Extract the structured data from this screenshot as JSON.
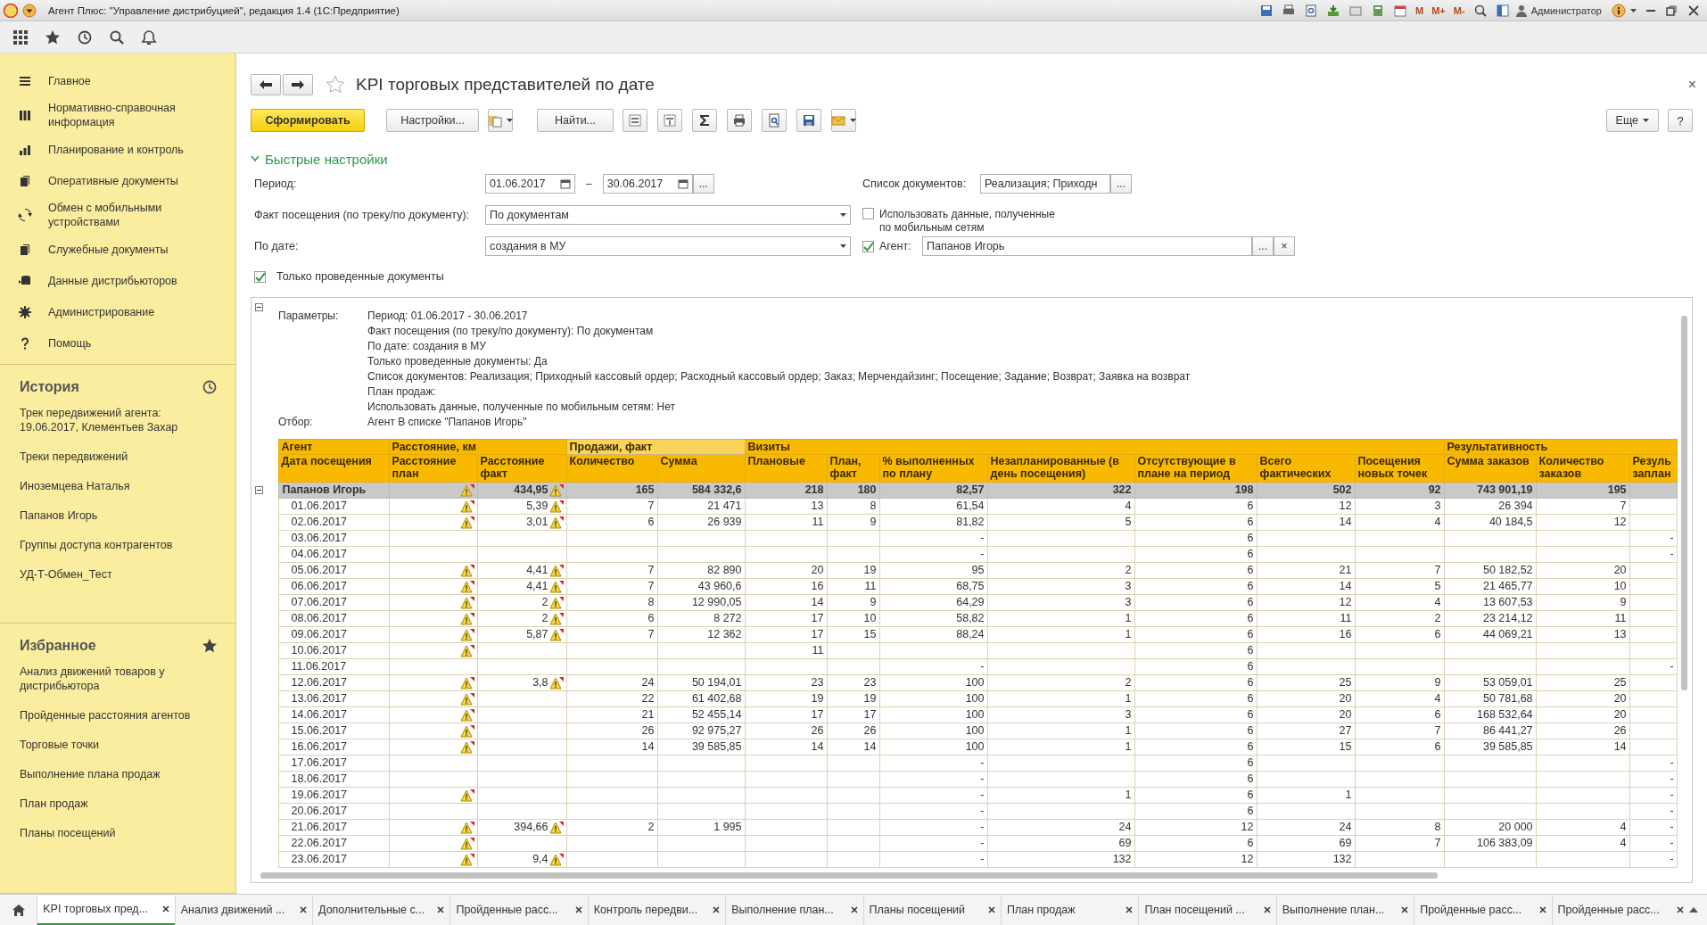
{
  "window": {
    "title": "Агент Плюс: \"Управление дистрибуцией\", редакция 1.4  (1С:Предприятие)",
    "memory_buttons": [
      "M",
      "M+",
      "M-"
    ],
    "user": "Администратор"
  },
  "sidebar": {
    "sections": [
      {
        "label": "Главное",
        "kind": "menu"
      },
      {
        "label": "Нормативно-справочная информация",
        "kind": "books"
      },
      {
        "label": "Планирование и контроль",
        "kind": "chart"
      },
      {
        "label": "Оперативные документы",
        "kind": "docs"
      },
      {
        "label": "Обмен с мобильными устройствами",
        "kind": "sync"
      },
      {
        "label": "Служебные документы",
        "kind": "docs"
      },
      {
        "label": "Данные дистрибьюторов",
        "kind": "db"
      },
      {
        "label": "Администрирование",
        "kind": "gear"
      },
      {
        "label": "Помощь",
        "kind": "help"
      }
    ],
    "history": {
      "title": "История",
      "items": [
        "Трек передвижений агента: 19.06.2017, Клементьев Захар",
        "Треки передвижений",
        "Иноземцева Наталья",
        "Папанов Игорь",
        "Группы доступа контрагентов",
        "УД-Т-Обмен_Тест"
      ]
    },
    "favorites": {
      "title": "Избранное",
      "items": [
        "Анализ движений товаров у дистрибьютора",
        "Пройденные расстояния агентов",
        "Торговые точки",
        "Выполнение плана продаж",
        "План продаж",
        "Планы посещений"
      ]
    }
  },
  "form": {
    "title": "KPI торговых представителей по дате",
    "close": "×",
    "toolbar": {
      "generate": "Сформировать",
      "settings": "Настройки...",
      "find": "Найти...",
      "more": "Еще",
      "help": "?"
    },
    "quick_settings": {
      "title": "Быстрые настройки",
      "expanded": true,
      "period": {
        "label": "Период:",
        "from": "01.06.2017",
        "dash": "–",
        "to": "30.06.2017",
        "more": "..."
      },
      "visit": {
        "label": "Факт посещения (по треку/по документу):",
        "value": "По документам"
      },
      "by_date": {
        "label": "По дате:",
        "value": "создания в МУ"
      },
      "posted_only": {
        "label": "Только проведенные документы",
        "checked": true
      },
      "doc_list": {
        "label": "Список документов:",
        "value": "Реализация; Приходн",
        "more": "..."
      },
      "mobile": {
        "label": "Использовать данные, полученные по мобильным сетям",
        "checked": false
      },
      "agent": {
        "label": "Агент:",
        "checked": true,
        "value": "Папанов Игорь",
        "more": "...",
        "clear": "×"
      }
    }
  },
  "report": {
    "parameters": [
      {
        "label": "Параметры:",
        "lines": [
          "Период: 01.06.2017 - 30.06.2017",
          "Факт посещения (по треку/по документу): По документам",
          "По дате: создания в МУ",
          "Только проведенные документы: Да",
          "Список документов: Реализация; Приходный кассовый ордер; Расходный кассовый ордер; Заказ; Мерчендайзинг; Посещение; Задание; Возврат; Заявка на возврат",
          "План продаж:",
          "Использовать данные, полученные по мобильным сетям: Нет"
        ]
      },
      {
        "label": "Отбор:",
        "lines": [
          "Агент В списке \"Папанов Игорь\""
        ]
      }
    ],
    "table": {
      "groups": [
        {
          "label": "Агент",
          "columns": [
            "Дата посещения"
          ]
        },
        {
          "label": "Расстояние, км",
          "columns": [
            "Расстояние план",
            "Расстояние факт"
          ]
        },
        {
          "label": "Продажи, факт",
          "columns": [
            "Количество",
            "Сумма"
          ]
        },
        {
          "label": "Визиты",
          "columns": [
            "Плановые",
            "План, факт",
            "% выполненных по плану",
            "Незапланированные (в день посещения)",
            "Отсутствующие в плане на период",
            "Всего фактических",
            "Посещения новых точек"
          ]
        },
        {
          "label": "Результативность",
          "columns": [
            "Сумма заказов",
            "Количество заказов",
            "Резуль заплан"
          ]
        }
      ],
      "rows": [
        {
          "kind": "group",
          "expanded": true,
          "date": "Папанов Игорь",
          "plan_warning": true,
          "fact_warning": true,
          "cells": [
            null,
            "434,95",
            "165",
            "584 332,6",
            "218",
            "180",
            "82,57",
            "322",
            "198",
            "502",
            "92",
            "743 901,19",
            "195",
            null
          ]
        },
        {
          "kind": "date",
          "date": "01.06.2017",
          "plan_warning": true,
          "fact_warning": true,
          "cells": [
            null,
            "5,39",
            "7",
            "21 471",
            "13",
            "8",
            "61,54",
            "4",
            "6",
            "12",
            "3",
            "26 394",
            "7",
            null
          ]
        },
        {
          "kind": "date",
          "date": "02.06.2017",
          "plan_warning": true,
          "fact_warning": true,
          "cells": [
            null,
            "3,01",
            "6",
            "26 939",
            "11",
            "9",
            "81,82",
            "5",
            "6",
            "14",
            "4",
            "40 184,5",
            "12",
            null
          ]
        },
        {
          "kind": "date",
          "date": "03.06.2017",
          "plan_warning": false,
          "fact_warning": false,
          "cells": [
            null,
            null,
            null,
            null,
            null,
            null,
            "-",
            null,
            "6",
            null,
            null,
            null,
            null,
            "-"
          ]
        },
        {
          "kind": "date",
          "date": "04.06.2017",
          "plan_warning": false,
          "fact_warning": false,
          "cells": [
            null,
            null,
            null,
            null,
            null,
            null,
            "-",
            null,
            "6",
            null,
            null,
            null,
            null,
            "-"
          ]
        },
        {
          "kind": "date",
          "date": "05.06.2017",
          "plan_warning": true,
          "fact_warning": true,
          "cells": [
            null,
            "4,41",
            "7",
            "82 890",
            "20",
            "19",
            "95",
            "2",
            "6",
            "21",
            "7",
            "50 182,52",
            "20",
            null
          ]
        },
        {
          "kind": "date",
          "date": "06.06.2017",
          "plan_warning": true,
          "fact_warning": true,
          "cells": [
            null,
            "4,41",
            "7",
            "43 960,6",
            "16",
            "11",
            "68,75",
            "3",
            "6",
            "14",
            "5",
            "21 465,77",
            "10",
            null
          ]
        },
        {
          "kind": "date",
          "date": "07.06.2017",
          "plan_warning": true,
          "fact_warning": true,
          "cells": [
            null,
            "2",
            "8",
            "12 990,05",
            "14",
            "9",
            "64,29",
            "3",
            "6",
            "12",
            "4",
            "13 607,53",
            "9",
            null
          ]
        },
        {
          "kind": "date",
          "date": "08.06.2017",
          "plan_warning": true,
          "fact_warning": true,
          "cells": [
            null,
            "2",
            "6",
            "8 272",
            "17",
            "10",
            "58,82",
            "1",
            "6",
            "11",
            "2",
            "23 214,12",
            "11",
            null
          ]
        },
        {
          "kind": "date",
          "date": "09.06.2017",
          "plan_warning": true,
          "fact_warning": true,
          "cells": [
            null,
            "5,87",
            "7",
            "12 362",
            "17",
            "15",
            "88,24",
            "1",
            "6",
            "16",
            "6",
            "44 069,21",
            "13",
            null
          ]
        },
        {
          "kind": "date",
          "date": "10.06.2017",
          "plan_warning": true,
          "fact_warning": false,
          "cells": [
            null,
            null,
            null,
            null,
            "11",
            null,
            null,
            null,
            "6",
            null,
            null,
            null,
            null,
            null
          ]
        },
        {
          "kind": "date",
          "date": "11.06.2017",
          "plan_warning": false,
          "fact_warning": false,
          "cells": [
            null,
            null,
            null,
            null,
            null,
            null,
            "-",
            null,
            "6",
            null,
            null,
            null,
            null,
            "-"
          ]
        },
        {
          "kind": "date",
          "date": "12.06.2017",
          "plan_warning": true,
          "fact_warning": true,
          "cells": [
            null,
            "3,8",
            "24",
            "50 194,01",
            "23",
            "23",
            "100",
            "2",
            "6",
            "25",
            "9",
            "53 059,01",
            "25",
            null
          ]
        },
        {
          "kind": "date",
          "date": "13.06.2017",
          "plan_warning": true,
          "fact_warning": false,
          "cells": [
            null,
            null,
            "22",
            "61 402,68",
            "19",
            "19",
            "100",
            "1",
            "6",
            "20",
            "4",
            "50 781,68",
            "20",
            null
          ]
        },
        {
          "kind": "date",
          "date": "14.06.2017",
          "plan_warning": true,
          "fact_warning": false,
          "cells": [
            null,
            null,
            "21",
            "52 455,14",
            "17",
            "17",
            "100",
            "3",
            "6",
            "20",
            "6",
            "168 532,64",
            "20",
            null
          ]
        },
        {
          "kind": "date",
          "date": "15.06.2017",
          "plan_warning": true,
          "fact_warning": false,
          "cells": [
            null,
            null,
            "26",
            "92 975,27",
            "26",
            "26",
            "100",
            "1",
            "6",
            "27",
            "7",
            "86 441,27",
            "26",
            null
          ]
        },
        {
          "kind": "date",
          "date": "16.06.2017",
          "plan_warning": true,
          "fact_warning": false,
          "cells": [
            null,
            null,
            "14",
            "39 585,85",
            "14",
            "14",
            "100",
            "1",
            "6",
            "15",
            "6",
            "39 585,85",
            "14",
            null
          ]
        },
        {
          "kind": "date",
          "date": "17.06.2017",
          "plan_warning": false,
          "fact_warning": false,
          "cells": [
            null,
            null,
            null,
            null,
            null,
            null,
            "-",
            null,
            "6",
            null,
            null,
            null,
            null,
            "-"
          ]
        },
        {
          "kind": "date",
          "date": "18.06.2017",
          "plan_warning": false,
          "fact_warning": false,
          "cells": [
            null,
            null,
            null,
            null,
            null,
            null,
            "-",
            null,
            "6",
            null,
            null,
            null,
            null,
            "-"
          ]
        },
        {
          "kind": "date",
          "date": "19.06.2017",
          "plan_warning": true,
          "fact_warning": false,
          "cells": [
            null,
            null,
            null,
            null,
            null,
            null,
            "-",
            "1",
            "6",
            "1",
            null,
            null,
            null,
            "-"
          ]
        },
        {
          "kind": "date",
          "date": "20.06.2017",
          "plan_warning": false,
          "fact_warning": false,
          "cells": [
            null,
            null,
            null,
            null,
            null,
            null,
            "-",
            null,
            "6",
            null,
            null,
            null,
            null,
            "-"
          ]
        },
        {
          "kind": "date",
          "date": "21.06.2017",
          "plan_warning": true,
          "fact_warning": true,
          "cells": [
            null,
            "394,66",
            "2",
            "1 995",
            null,
            null,
            "-",
            "24",
            "12",
            "24",
            "8",
            "20 000",
            "4",
            "-"
          ]
        },
        {
          "kind": "date",
          "date": "22.06.2017",
          "plan_warning": true,
          "fact_warning": false,
          "cells": [
            null,
            null,
            null,
            null,
            null,
            null,
            "-",
            "69",
            "6",
            "69",
            "7",
            "106 383,09",
            "4",
            "-"
          ]
        },
        {
          "kind": "date",
          "date": "23.06.2017",
          "plan_warning": true,
          "fact_warning": true,
          "cells": [
            null,
            "9,4",
            null,
            null,
            null,
            null,
            "-",
            "132",
            "12",
            "132",
            null,
            null,
            null,
            "-"
          ]
        }
      ]
    }
  },
  "tabs": [
    {
      "label": "KPI торговых пред...",
      "selected": true
    },
    {
      "label": "Анализ движений ...",
      "selected": false
    },
    {
      "label": "Дополнительные с...",
      "selected": false
    },
    {
      "label": "Пройденные расс...",
      "selected": false
    },
    {
      "label": "Контроль передви...",
      "selected": false
    },
    {
      "label": "Выполнение план...",
      "selected": false
    },
    {
      "label": "Планы посещений",
      "selected": false
    },
    {
      "label": "План продаж",
      "selected": false
    },
    {
      "label": "План посещений ...",
      "selected": false
    },
    {
      "label": "Выполнение план...",
      "selected": false
    },
    {
      "label": "Пройденные расс...",
      "selected": false
    },
    {
      "label": "Пройденные расс...",
      "selected": false
    }
  ]
}
